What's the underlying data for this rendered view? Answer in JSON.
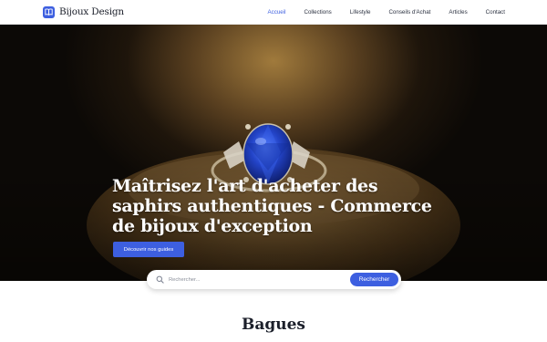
{
  "header": {
    "brand": "Bijoux Design",
    "nav": [
      {
        "label": "Accueil",
        "active": true
      },
      {
        "label": "Collections"
      },
      {
        "label": "Lifestyle"
      },
      {
        "label": "Conseils d'Achat"
      },
      {
        "label": "Articles"
      },
      {
        "label": "Contact"
      }
    ]
  },
  "hero": {
    "title": "Maîtrisez l'art d'acheter des saphirs authentiques - Commerce de bijoux d'exception",
    "cta_label": "Découvrir nos guides"
  },
  "search": {
    "placeholder": "Rechercher...",
    "button_label": "Rechercher"
  },
  "section": {
    "title": "Bagues"
  },
  "colors": {
    "accent": "#3d5fe0",
    "sapphire": "#1f3fb0"
  },
  "icons": [
    "book-icon",
    "search-icon"
  ]
}
